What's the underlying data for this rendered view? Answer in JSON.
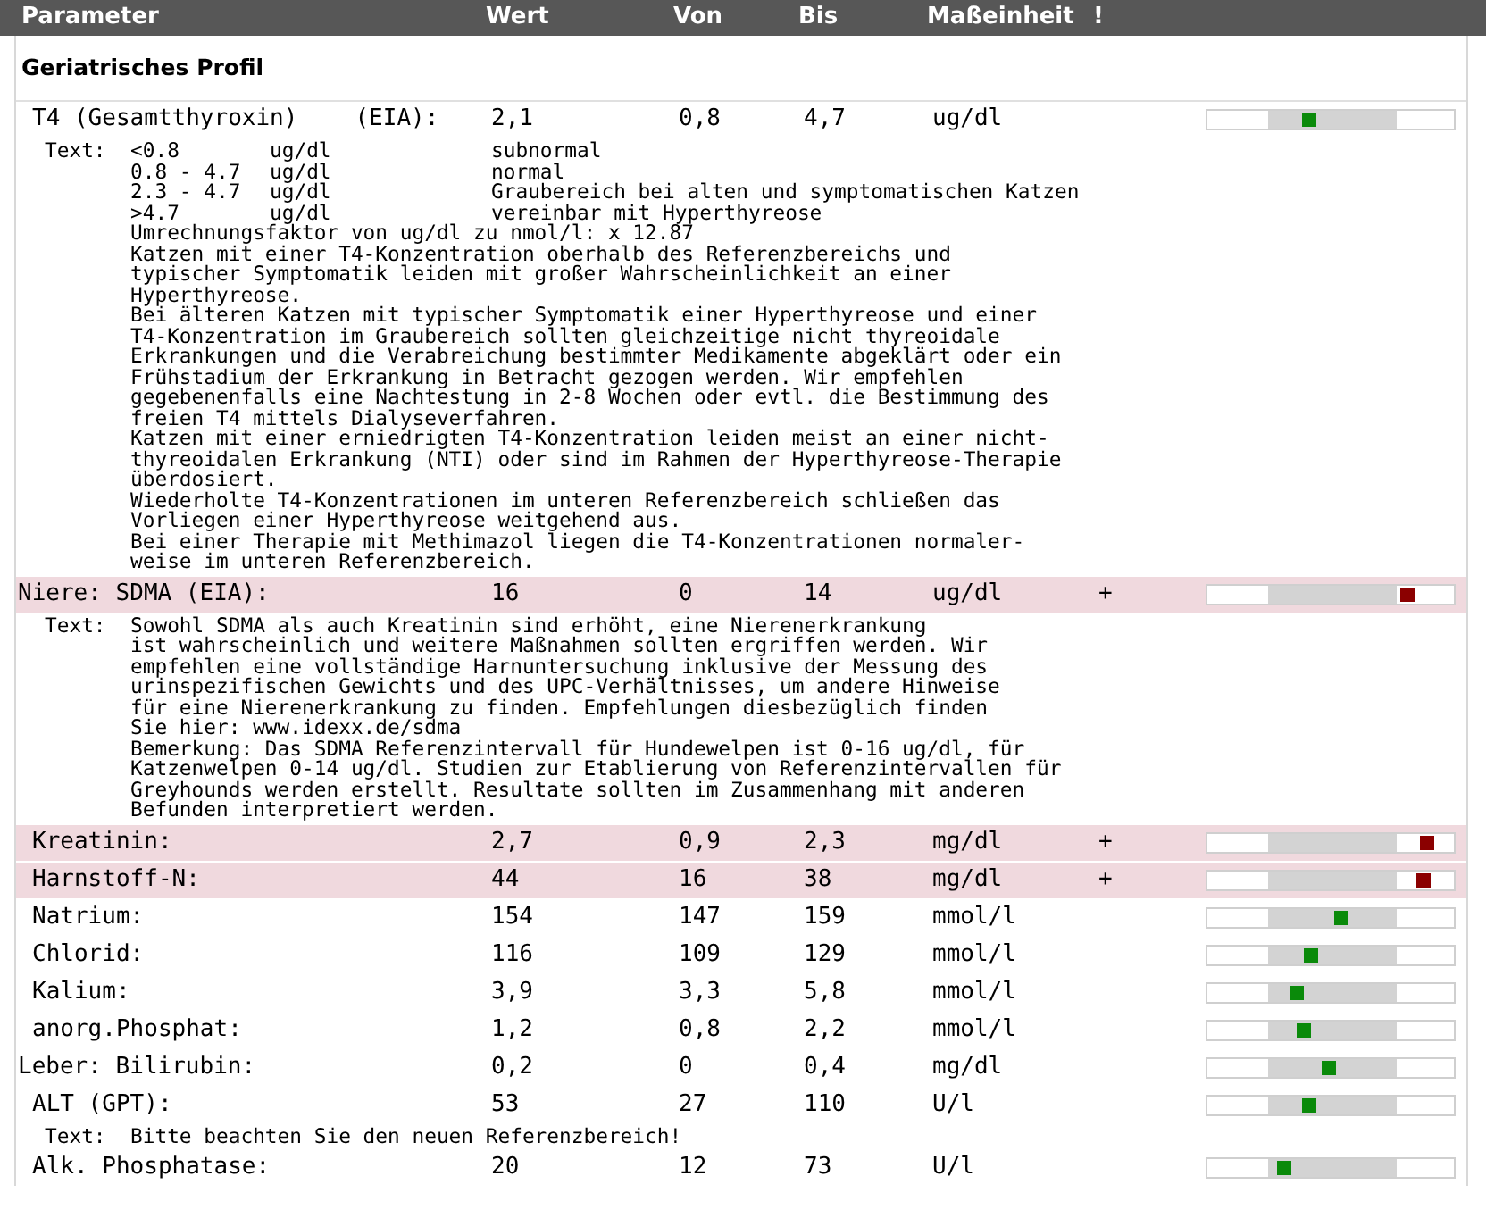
{
  "columns": [
    "Parameter",
    "Wert",
    "Von",
    "Bis",
    "Maßeinheit",
    "!"
  ],
  "section": {
    "title": "Geriatrisches Profil"
  },
  "rows": [
    {
      "kind": "result",
      "name": "T4 (Gesamtthyroxin)",
      "method": "(EIA):",
      "group_start": false,
      "value": "2,1",
      "from": "0,8",
      "to": "4,7",
      "unit": "ug/dl",
      "abnormal": false,
      "level": 0.41
    },
    {
      "kind": "text",
      "label": "Text:",
      "table": [
        [
          "<0.8",
          "ug/dl",
          "subnormal"
        ],
        [
          "0.8 - 4.7",
          "ug/dl",
          "normal"
        ],
        [
          "2.3 - 4.7",
          "ug/dl",
          "Graubereich bei alten und symptomatischen Katzen"
        ],
        [
          ">4.7",
          "ug/dl",
          "vereinbar mit Hyperthyreose"
        ]
      ],
      "lines": [
        "Umrechnungsfaktor von ug/dl zu nmol/l: x 12.87",
        "Katzen mit einer T4-Konzentration oberhalb des Referenzbereichs und",
        "typischer Symptomatik leiden mit großer Wahrscheinlichkeit an einer",
        "Hyperthyreose.",
        "Bei älteren Katzen mit typischer Symptomatik einer Hyperthyreose und einer",
        "T4-Konzentration im Graubereich sollten gleichzeitige nicht thyreoidale",
        "Erkrankungen und die Verabreichung bestimmter Medikamente abgeklärt oder ein",
        "Frühstadium der Erkrankung in Betracht gezogen werden. Wir empfehlen",
        "gegebenenfalls eine Nachtestung in 2-8 Wochen oder evtl. die Bestimmung des",
        "freien T4 mittels Dialyseverfahren.",
        "Katzen mit einer erniedrigten T4-Konzentration leiden meist an einer nicht-",
        "thyreoidalen Erkrankung (NTI) oder sind im Rahmen der Hyperthyreose-Therapie",
        "überdosiert.",
        "Wiederholte T4-Konzentrationen im unteren Referenzbereich schließen das",
        "Vorliegen einer Hyperthyreose weitgehend aus.",
        "Bei einer Therapie mit Methimazol liegen die T4-Konzentrationen normaler-",
        "weise im unteren Referenzbereich."
      ]
    },
    {
      "kind": "result",
      "name": "Niere: SDMA (EIA):",
      "group_start": true,
      "value": "16",
      "from": "0",
      "to": "14",
      "unit": "ug/dl",
      "flag": "+",
      "abnormal": true,
      "level": 0.81
    },
    {
      "kind": "text",
      "label": "Text:",
      "lines": [
        "Sowohl SDMA als auch Kreatinin sind erhöht, eine Nierenerkrankung",
        "ist wahrscheinlich und weitere Maßnahmen sollten ergriffen werden. Wir",
        "empfehlen eine vollständige Harnuntersuchung inklusive der Messung des",
        "urinspezifischen Gewichts und des UPC-Verhältnisses, um andere Hinweise",
        "für eine Nierenerkrankung zu finden. Empfehlungen diesbezüglich finden",
        "Sie hier: www.idexx.de/sdma",
        "Bemerkung: Das SDMA Referenzintervall für Hundewelpen ist 0-16 ug/dl, für",
        "Katzenwelpen 0-14 ug/dl. Studien zur Etablierung von Referenzintervallen für",
        "Greyhounds werden erstellt. Resultate sollten im Zusammenhang mit anderen",
        "Befunden interpretiert werden."
      ]
    },
    {
      "kind": "result",
      "name": "Kreatinin:",
      "group_start": false,
      "value": "2,7",
      "from": "0,9",
      "to": "2,3",
      "unit": "mg/dl",
      "flag": "+",
      "abnormal": true,
      "level": 0.89
    },
    {
      "kind": "result",
      "name": "Harnstoff-N:",
      "group_start": false,
      "value": "44",
      "from": "16",
      "to": "38",
      "unit": "mg/dl",
      "flag": "+",
      "abnormal": true,
      "level": 0.88
    },
    {
      "kind": "result",
      "name": "Natrium:",
      "group_start": false,
      "value": "154",
      "from": "147",
      "to": "159",
      "unit": "mmol/l",
      "abnormal": false,
      "level": 0.54
    },
    {
      "kind": "result",
      "name": "Chlorid:",
      "group_start": false,
      "value": "116",
      "from": "109",
      "to": "129",
      "unit": "mmol/l",
      "abnormal": false,
      "level": 0.42
    },
    {
      "kind": "result",
      "name": "Kalium:",
      "group_start": false,
      "value": "3,9",
      "from": "3,3",
      "to": "5,8",
      "unit": "mmol/l",
      "abnormal": false,
      "level": 0.36
    },
    {
      "kind": "result",
      "name": "anorg.Phosphat:",
      "group_start": false,
      "value": "1,2",
      "from": "0,8",
      "to": "2,2",
      "unit": "mmol/l",
      "abnormal": false,
      "level": 0.39
    },
    {
      "kind": "result",
      "name": "Leber: Bilirubin:",
      "group_start": true,
      "value": "0,2",
      "from": "0",
      "to": "0,4",
      "unit": "mg/dl",
      "abnormal": false,
      "level": 0.49
    },
    {
      "kind": "result",
      "name": "ALT (GPT):",
      "group_start": false,
      "value": "53",
      "from": "27",
      "to": "110",
      "unit": "U/l",
      "abnormal": false,
      "level": 0.41
    },
    {
      "kind": "text",
      "label": "Text:",
      "lines": [
        "Bitte beachten Sie den neuen Referenzbereich!"
      ]
    },
    {
      "kind": "result",
      "name": "Alk. Phosphatase:",
      "group_start": false,
      "value": "20",
      "from": "12",
      "to": "73",
      "unit": "U/l",
      "abnormal": false,
      "level": 0.31
    }
  ]
}
